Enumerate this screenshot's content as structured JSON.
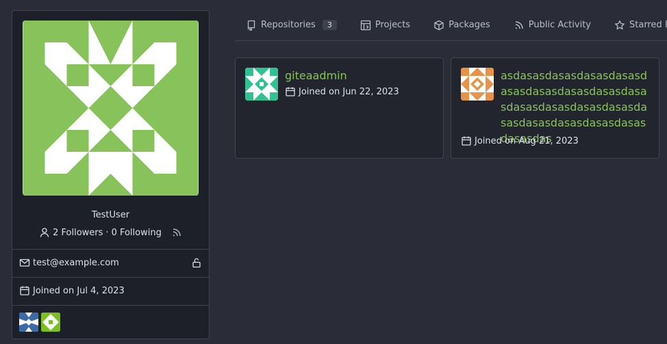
{
  "profile": {
    "username": "TestUser",
    "followers": "2 Followers",
    "separator": "·",
    "following": "0 Following",
    "email": "test@example.com",
    "joined": "Joined on Jul 4, 2023"
  },
  "tabs": [
    {
      "label": "Repositories",
      "badge": "3",
      "icon": "repo-icon"
    },
    {
      "label": "Projects",
      "icon": "project-icon"
    },
    {
      "label": "Packages",
      "icon": "package-icon"
    },
    {
      "label": "Public Activity",
      "icon": "rss-icon"
    },
    {
      "label": "Starred Re",
      "icon": "star-icon"
    }
  ],
  "users": [
    {
      "name": "giteaadmin",
      "joined": "Joined on Jun 22, 2023"
    },
    {
      "name": "asdasasdasasdasasdasasdasasdasasdasasdasasdasasdasasdasasdasasdasasdasasdasasdasasdasasdasasdasasdas",
      "joined": "Joined on Aug 21, 2023"
    }
  ],
  "colors": {
    "accent": "#87c25a",
    "avatar_green": "#87c25a",
    "avatar_teal": "#31c28f",
    "avatar_orange": "#e8934a",
    "avatar_blue": "#3b6aa8",
    "avatar_lime": "#79c11f"
  }
}
